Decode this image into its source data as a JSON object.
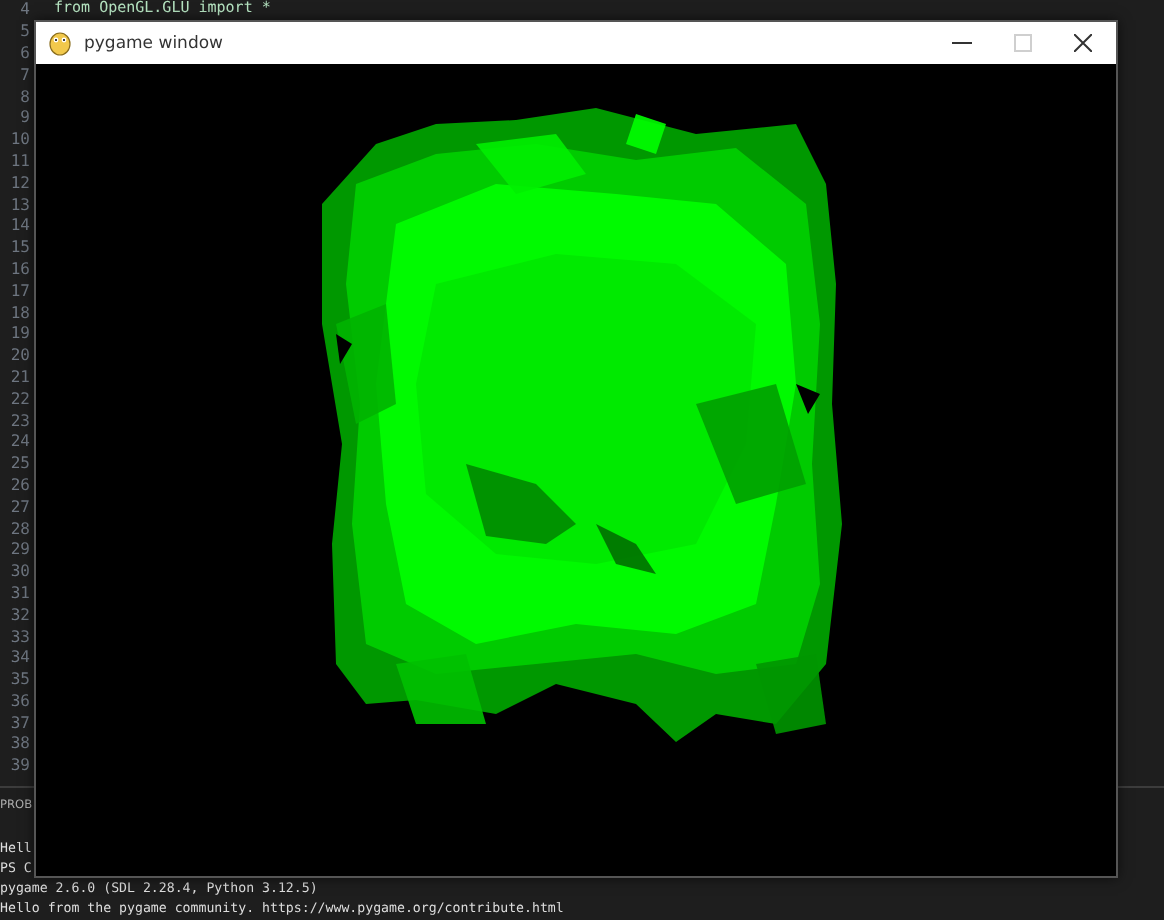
{
  "editor": {
    "lines": [
      {
        "number": "4",
        "code": "from OpenGL.GLU import *"
      },
      {
        "number": "5"
      },
      {
        "number": "6"
      },
      {
        "number": "7"
      },
      {
        "number": "8"
      },
      {
        "number": "9"
      },
      {
        "number": "10"
      },
      {
        "number": "11"
      },
      {
        "number": "12"
      },
      {
        "number": "13"
      },
      {
        "number": "14"
      },
      {
        "number": "15"
      },
      {
        "number": "16"
      },
      {
        "number": "17"
      },
      {
        "number": "18"
      },
      {
        "number": "19"
      },
      {
        "number": "20"
      },
      {
        "number": "21"
      },
      {
        "number": "22"
      },
      {
        "number": "23"
      },
      {
        "number": "24"
      },
      {
        "number": "25"
      },
      {
        "number": "26"
      },
      {
        "number": "27"
      },
      {
        "number": "28"
      },
      {
        "number": "29"
      },
      {
        "number": "30"
      },
      {
        "number": "31"
      },
      {
        "number": "32"
      },
      {
        "number": "33"
      },
      {
        "number": "34"
      },
      {
        "number": "35"
      },
      {
        "number": "36"
      },
      {
        "number": "37"
      },
      {
        "number": "38"
      },
      {
        "number": "39"
      }
    ]
  },
  "panel": {
    "tab": "PROB"
  },
  "terminal": {
    "lines": [
      "Hell",
      "PS C",
      "pygame 2.6.0 (SDL 2.28.4, Python 3.12.5)",
      "Hello from the pygame community. https://www.pygame.org/contribute.html"
    ]
  },
  "window": {
    "title": "pygame window",
    "controls": [
      {
        "kind": "minimize",
        "disabled": false
      },
      {
        "kind": "maximize",
        "disabled": true
      },
      {
        "kind": "close",
        "disabled": false
      }
    ]
  }
}
